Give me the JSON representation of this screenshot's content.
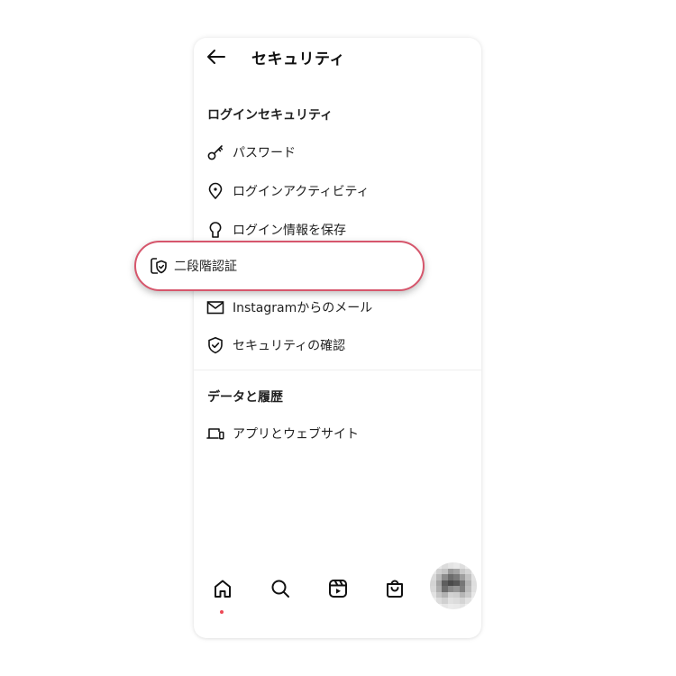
{
  "header": {
    "back_icon": "arrow-left-icon",
    "title": "セキュリティ"
  },
  "sections": [
    {
      "title": "ログインセキュリティ",
      "items": [
        {
          "label": "パスワード",
          "icon": "key-icon"
        },
        {
          "label": "ログインアクティビティ",
          "icon": "location-pin-icon"
        },
        {
          "label": "ログイン情報を保存",
          "icon": "keyhole-icon"
        },
        {
          "label": "二段階認証",
          "icon": "shield-phone-icon",
          "highlighted": true
        },
        {
          "label": "Instagramからのメール",
          "icon": "mail-icon"
        },
        {
          "label": "セキュリティの確認",
          "icon": "shield-check-icon"
        }
      ]
    },
    {
      "title": "データと履歴",
      "items": [
        {
          "label": "アプリとウェブサイト",
          "icon": "devices-icon"
        }
      ]
    }
  ],
  "bottom_nav": [
    {
      "name": "home",
      "icon": "home-icon",
      "active": true
    },
    {
      "name": "search",
      "icon": "search-icon"
    },
    {
      "name": "reels",
      "icon": "reels-icon"
    },
    {
      "name": "shop",
      "icon": "shop-bag-icon"
    },
    {
      "name": "profile",
      "icon": "avatar"
    }
  ],
  "colors": {
    "highlight_border": "#d6566c",
    "notification_dot": "#ed4956",
    "text": "#222222"
  }
}
